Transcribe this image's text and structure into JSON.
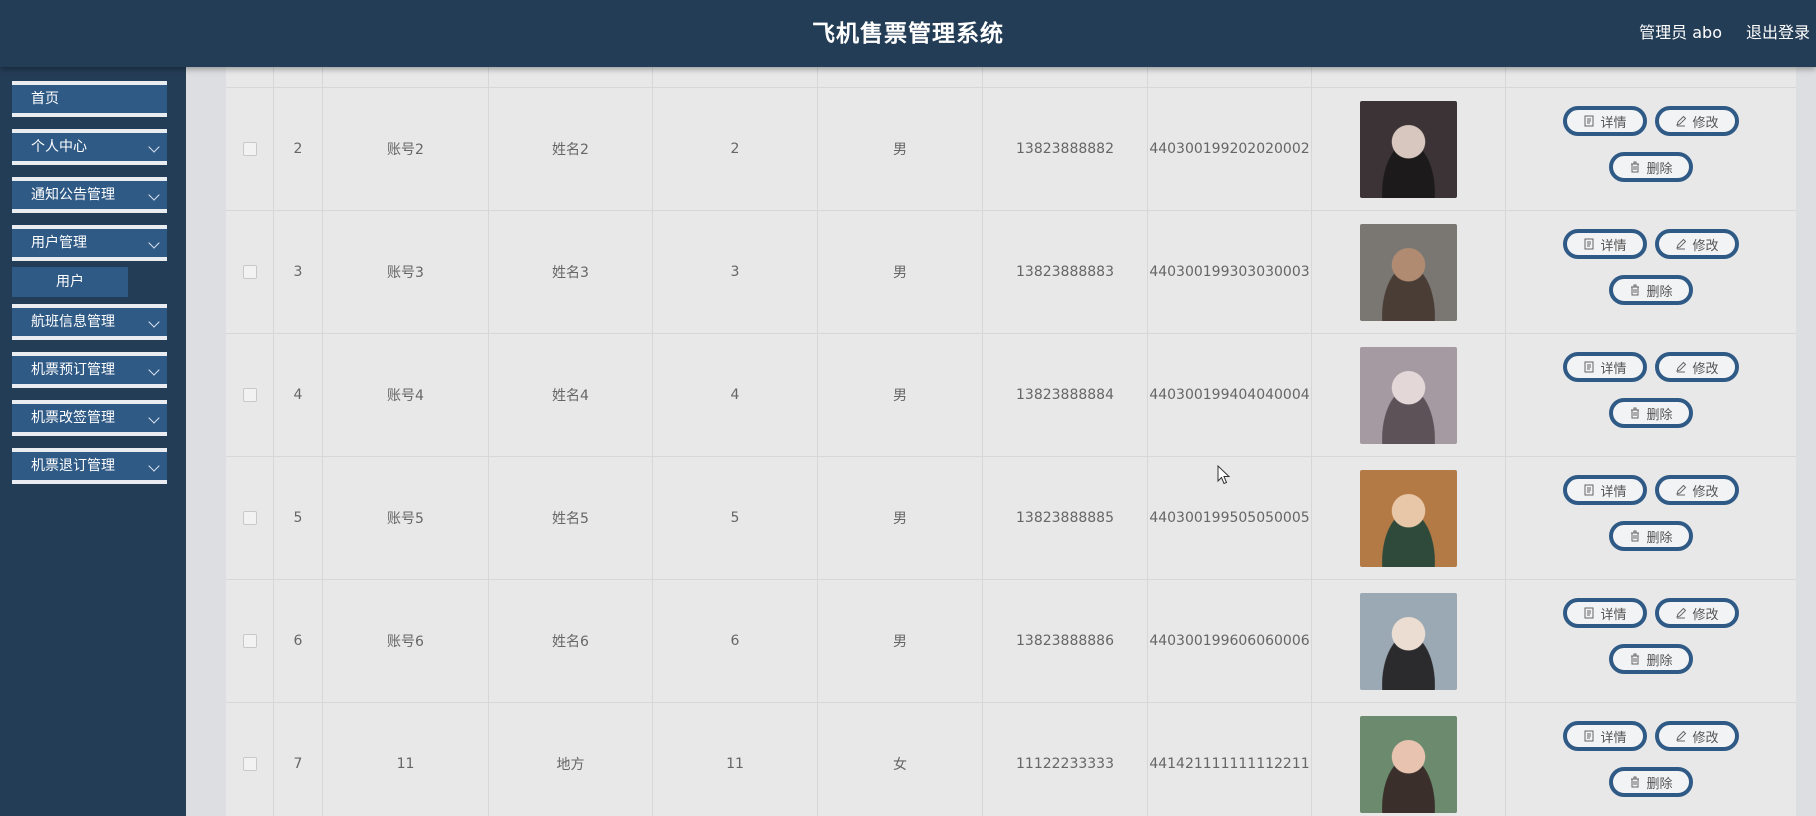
{
  "header": {
    "title": "飞机售票管理系统",
    "user_label": "管理员 abo",
    "logout_label": "退出登录"
  },
  "sidebar": {
    "items": [
      {
        "label": "首页",
        "has_children": false
      },
      {
        "label": "个人中心",
        "has_children": true
      },
      {
        "label": "通知公告管理",
        "has_children": true
      },
      {
        "label": "用户管理",
        "has_children": true
      },
      {
        "label": "航班信息管理",
        "has_children": true
      },
      {
        "label": "机票预订管理",
        "has_children": true
      },
      {
        "label": "机票改签管理",
        "has_children": true
      },
      {
        "label": "机票退订管理",
        "has_children": true
      }
    ],
    "submenu_label": "用户"
  },
  "table": {
    "actions": {
      "detail": "详情",
      "edit": "修改",
      "delete": "删除"
    },
    "rows": [
      {
        "index": "2",
        "account": "账号2",
        "name": "姓名2",
        "age": "2",
        "gender": "男",
        "phone": "13823888882",
        "id_number": "440300199202020002",
        "photo_colors": [
          "#3b3335",
          "#d8c7be",
          "#1d1a1b"
        ]
      },
      {
        "index": "3",
        "account": "账号3",
        "name": "姓名3",
        "age": "3",
        "gender": "男",
        "phone": "13823888883",
        "id_number": "440300199303030003",
        "photo_colors": [
          "#7a7672",
          "#b08b72",
          "#4a3d36"
        ]
      },
      {
        "index": "4",
        "account": "账号4",
        "name": "姓名4",
        "age": "4",
        "gender": "男",
        "phone": "13823888884",
        "id_number": "440300199404040004",
        "photo_colors": [
          "#a69aa2",
          "#e4d7d8",
          "#5c5258"
        ]
      },
      {
        "index": "5",
        "account": "账号5",
        "name": "姓名5",
        "age": "5",
        "gender": "男",
        "phone": "13823888885",
        "id_number": "440300199505050005",
        "photo_colors": [
          "#b47a45",
          "#e8c7a8",
          "#2f4a3a"
        ]
      },
      {
        "index": "6",
        "account": "账号6",
        "name": "姓名6",
        "age": "6",
        "gender": "男",
        "phone": "13823888886",
        "id_number": "440300199606060006",
        "photo_colors": [
          "#9aa9b3",
          "#ecddd2",
          "#2b2b2e"
        ]
      },
      {
        "index": "7",
        "account": "11",
        "name": "地方",
        "age": "11",
        "gender": "女",
        "phone": "11122233333",
        "id_number": "441421111111112211",
        "photo_colors": [
          "#6b8a6e",
          "#e8c4b0",
          "#3a2f2a"
        ]
      }
    ]
  }
}
